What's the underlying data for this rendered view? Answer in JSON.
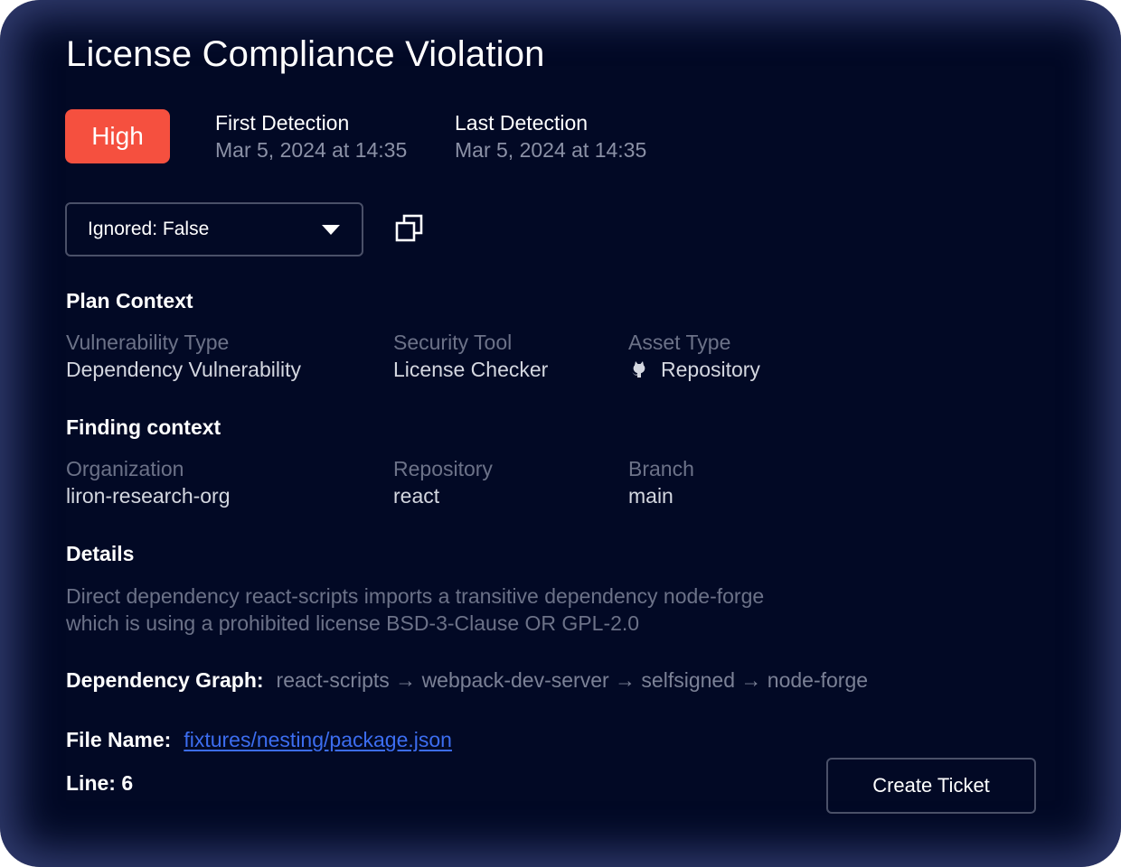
{
  "title": "License Compliance Violation",
  "severity": {
    "label": "High",
    "color": "#f5503f"
  },
  "detections": {
    "first": {
      "label": "First Detection",
      "value": "Mar 5, 2024 at 14:35"
    },
    "last": {
      "label": "Last Detection",
      "value": "Mar 5, 2024 at 14:35"
    }
  },
  "ignored_select": {
    "value": "Ignored: False"
  },
  "icons": {
    "copy": "copy-icon",
    "repo": "github-icon",
    "caret": "caret-down-icon"
  },
  "plan_context": {
    "title": "Plan Context",
    "vulnerability_type": {
      "label": "Vulnerability Type",
      "value": "Dependency Vulnerability"
    },
    "security_tool": {
      "label": "Security Tool",
      "value": "License Checker"
    },
    "asset_type": {
      "label": "Asset Type",
      "value": "Repository"
    }
  },
  "finding_context": {
    "title": "Finding context",
    "organization": {
      "label": "Organization",
      "value": "liron-research-org"
    },
    "repository": {
      "label": "Repository",
      "value": "react"
    },
    "branch": {
      "label": "Branch",
      "value": "main"
    }
  },
  "details": {
    "title": "Details",
    "line1": "Direct dependency react-scripts imports a transitive dependency node-forge",
    "line2": "which is using a prohibited license BSD-3-Clause OR GPL-2.0"
  },
  "dependency_graph": {
    "label": "Dependency Graph:",
    "value": "react-scripts → webpack-dev-server → selfsigned → node-forge"
  },
  "file": {
    "label": "File Name:",
    "value": "fixtures/nesting/package.json"
  },
  "line": {
    "label": "Line: 6"
  },
  "actions": {
    "create_ticket": "Create Ticket"
  }
}
